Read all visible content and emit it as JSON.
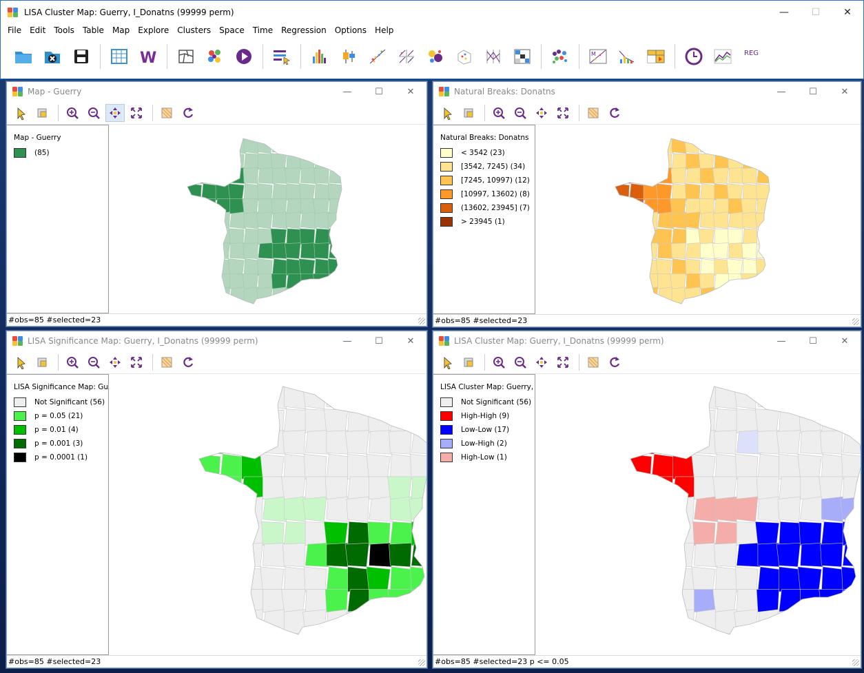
{
  "app": {
    "title": "LISA Cluster Map: Guerry, I_Donatns (99999 perm)",
    "menu": [
      "File",
      "Edit",
      "Tools",
      "Table",
      "Map",
      "Explore",
      "Clusters",
      "Space",
      "Time",
      "Regression",
      "Options",
      "Help"
    ],
    "toolbar_icons": [
      "open-folder-icon",
      "close-project-icon",
      "save-icon",
      "table-icon",
      "weights-icon",
      "map-icon",
      "cluster-dots-icon",
      "play-icon",
      "sort-select-icon",
      "histogram-icon",
      "box-plot-icon",
      "scatter-plot-icon",
      "scatter-matrix-icon",
      "bubble-chart-icon",
      "3d-scatter-icon",
      "parallel-coord-icon",
      "conditional-plot-icon",
      "cluster-icon",
      "moran-scatter-icon",
      "lisa-icon",
      "map-movie-icon",
      "time-icon",
      "line-chart-icon",
      "regression-icon"
    ],
    "regression_label": "REG",
    "colors": {
      "accent": "#2b73c8"
    }
  },
  "windows": {
    "map": {
      "title": "Map - Guerry",
      "legend_title": "Map - Guerry",
      "legend": [
        {
          "label": "(85)",
          "color": "#2e9152"
        }
      ],
      "status": "#obs=85 #selected=23"
    },
    "natural_breaks": {
      "title": "Natural Breaks: Donatns",
      "legend_title": "Natural Breaks: Donatns",
      "legend": [
        {
          "label": "< 3542 (23)",
          "color": "#ffffcc"
        },
        {
          "label": "[3542, 7245) (34)",
          "color": "#fee391"
        },
        {
          "label": "[7245, 10997) (12)",
          "color": "#fec44f"
        },
        {
          "label": "[10997, 13602) (8)",
          "color": "#fe9929"
        },
        {
          "label": "(13602, 23945] (7)",
          "color": "#d95f0e"
        },
        {
          "label": "> 23945 (1)",
          "color": "#993404"
        }
      ],
      "status": "#obs=85 #selected=23"
    },
    "significance": {
      "title": "LISA Significance Map: Guerry, I_Donatns (99999 perm)",
      "legend_title": "LISA Significance Map: Gue",
      "legend": [
        {
          "label": "Not Significant (56)",
          "color": "#eeeeee"
        },
        {
          "label": "p = 0.05 (21)",
          "color": "#4cf24c"
        },
        {
          "label": "p = 0.01 (4)",
          "color": "#00bf00"
        },
        {
          "label": "p = 0.001 (3)",
          "color": "#006b00"
        },
        {
          "label": "p = 0.0001 (1)",
          "color": "#000000"
        }
      ],
      "status": "#obs=85 #selected=23"
    },
    "cluster": {
      "title": "LISA Cluster Map: Guerry, I_Donatns (99999 perm)",
      "legend_title": "LISA Cluster Map: Guerry, I_",
      "legend": [
        {
          "label": "Not Significant (56)",
          "color": "#eeeeee"
        },
        {
          "label": "High-High (9)",
          "color": "#ff0000"
        },
        {
          "label": "Low-Low (17)",
          "color": "#0000ff"
        },
        {
          "label": "Low-High (2)",
          "color": "#a7adf9"
        },
        {
          "label": "High-Low (1)",
          "color": "#f4ada8"
        }
      ],
      "status": "#obs=85 #selected=23  p <= 0.05"
    }
  }
}
